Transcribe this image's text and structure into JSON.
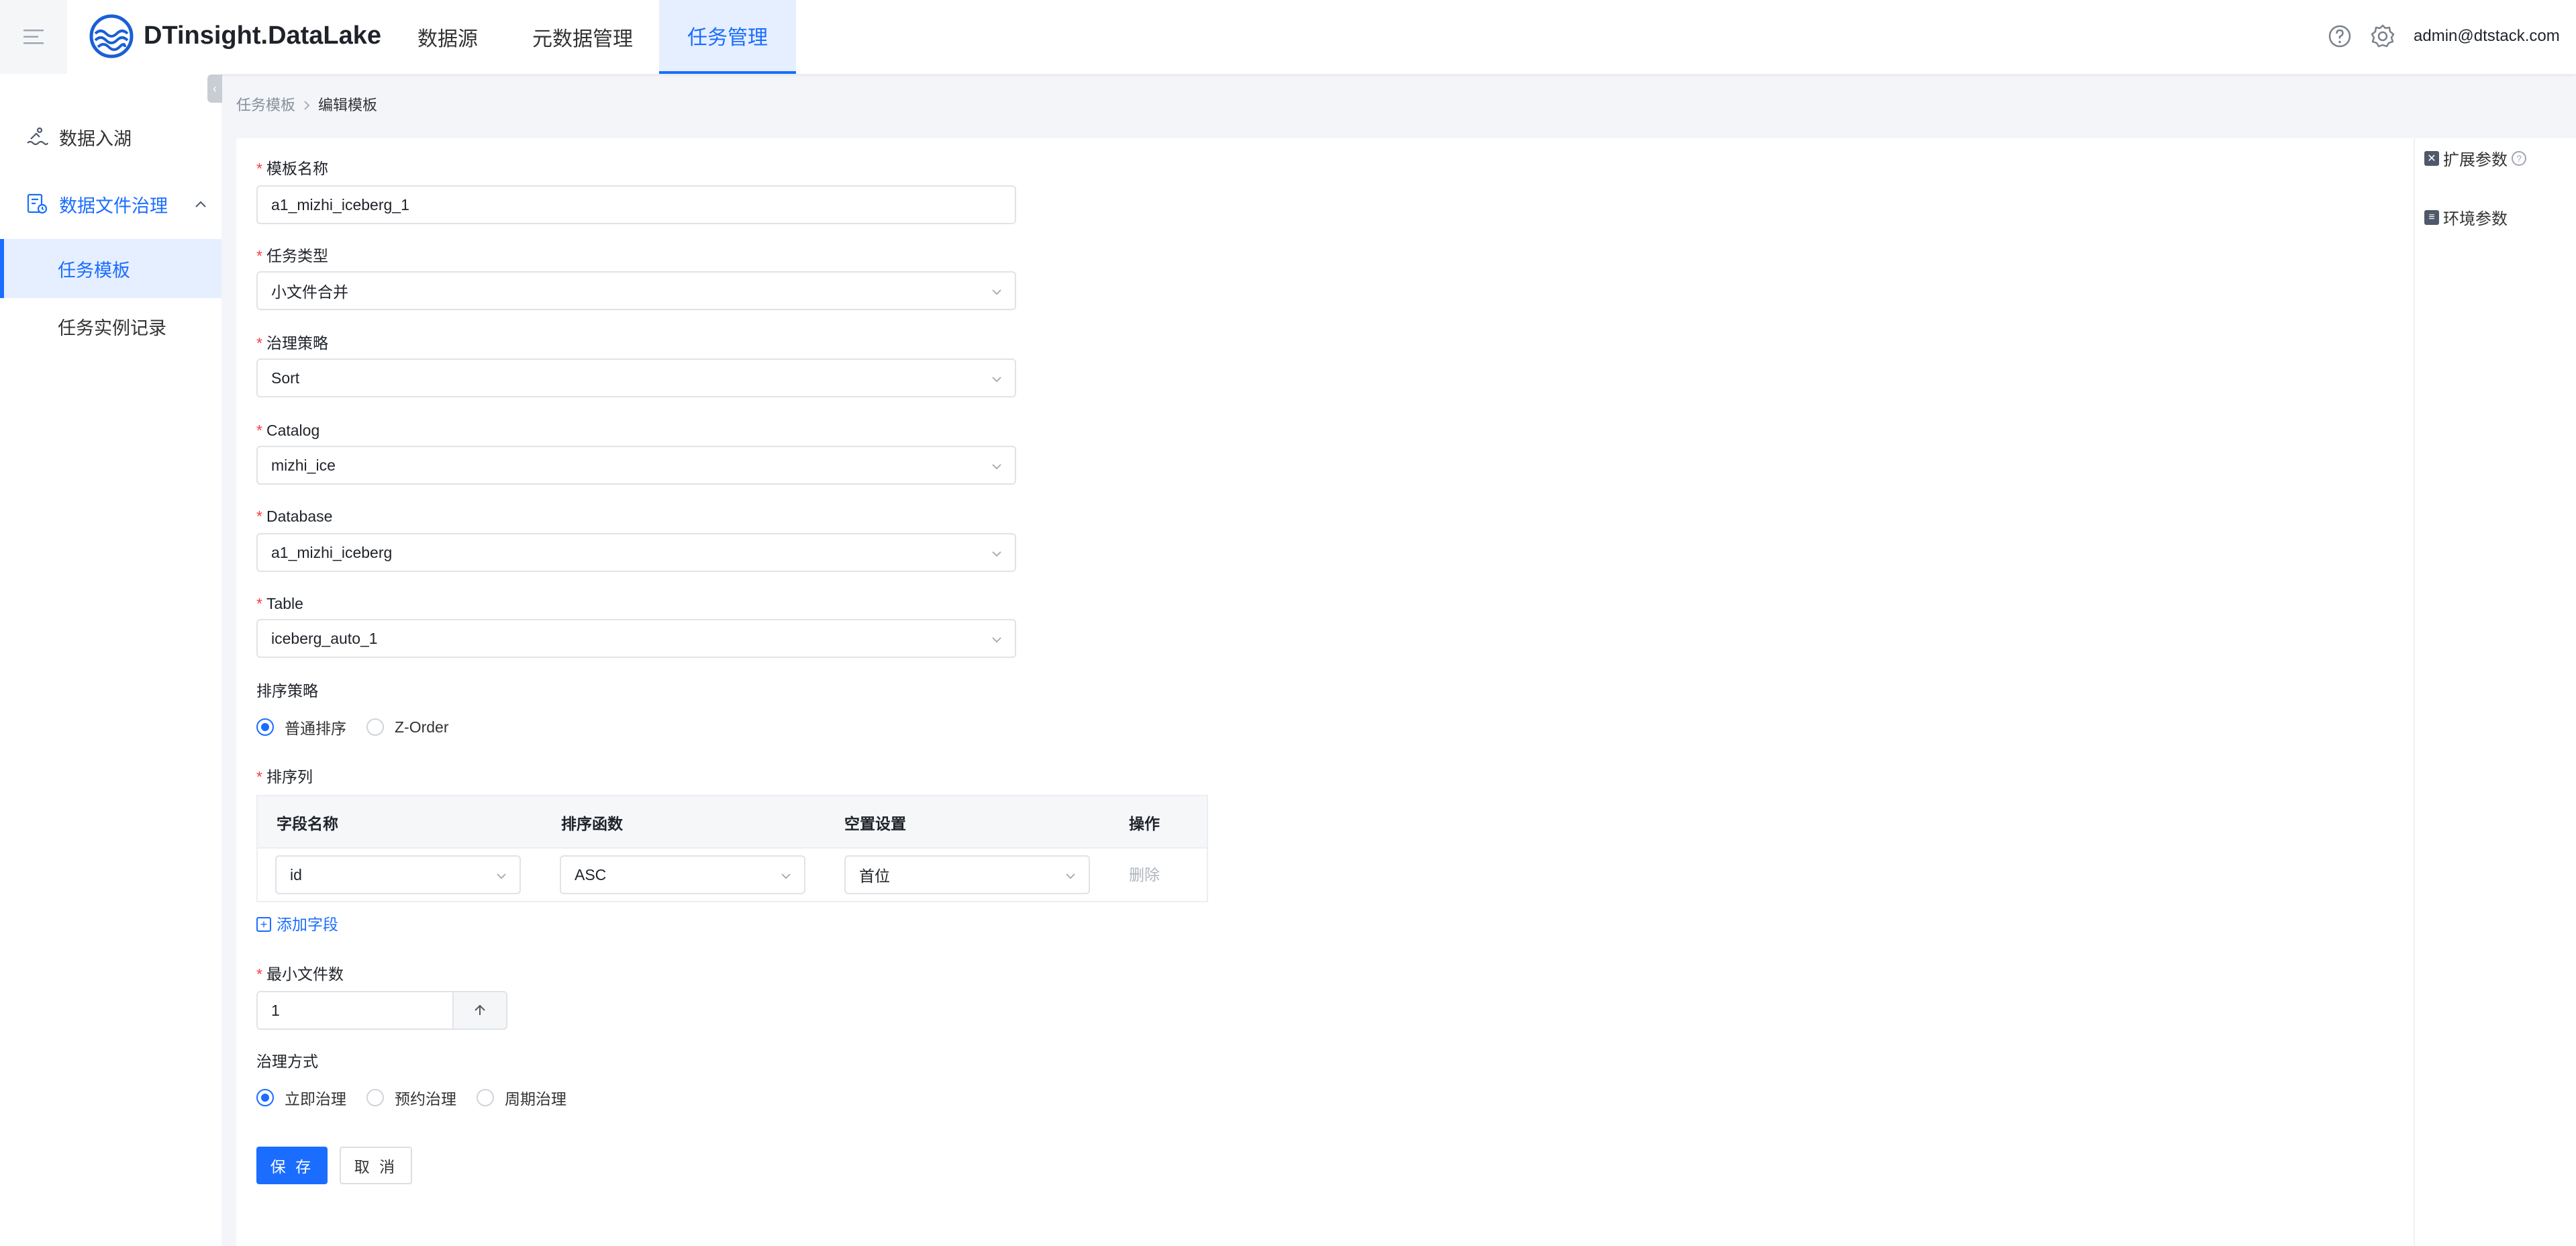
{
  "header": {
    "brand": "DTinsight.DataLake",
    "nav": [
      {
        "label": "数据源",
        "active": false
      },
      {
        "label": "元数据管理",
        "active": false
      },
      {
        "label": "任务管理",
        "active": true
      }
    ],
    "user": "admin@dtstack.com"
  },
  "sidebar": {
    "items": [
      {
        "label": "数据入湖",
        "icon": "swim-icon"
      },
      {
        "label": "数据文件治理",
        "icon": "file-governance-icon",
        "expanded": true
      },
      {
        "label": "任务模板",
        "active": true
      },
      {
        "label": "任务实例记录",
        "active": false
      }
    ]
  },
  "breadcrumb": {
    "parent": "任务模板",
    "current": "编辑模板"
  },
  "right_panel": {
    "ext_params": "扩展参数",
    "env_params": "环境参数"
  },
  "form": {
    "template_name": {
      "label": "模板名称",
      "value": "a1_mizhi_iceberg_1"
    },
    "task_type": {
      "label": "任务类型",
      "value": "小文件合并"
    },
    "strategy": {
      "label": "治理策略",
      "value": "Sort"
    },
    "catalog": {
      "label": "Catalog",
      "value": "mizhi_ice"
    },
    "database": {
      "label": "Database",
      "value": "a1_mizhi_iceberg"
    },
    "table": {
      "label": "Table",
      "value": "iceberg_auto_1"
    },
    "sort_strategy": {
      "label": "排序策略",
      "options": [
        "普通排序",
        "Z-Order"
      ],
      "selected": "普通排序"
    },
    "sort_columns": {
      "label": "排序列",
      "headers": [
        "字段名称",
        "排序函数",
        "空置设置",
        "操作"
      ],
      "rows": [
        {
          "field": "id",
          "func": "ASC",
          "nulls": "首位",
          "action": "删除"
        }
      ],
      "add_label": "添加字段"
    },
    "min_files": {
      "label": "最小文件数",
      "value": "1"
    },
    "mode": {
      "label": "治理方式",
      "options": [
        "立即治理",
        "预约治理",
        "周期治理"
      ],
      "selected": "立即治理"
    },
    "save": "保 存",
    "cancel": "取 消"
  },
  "colors": {
    "accent": "#1a6dff",
    "required": "#f53f3f"
  }
}
